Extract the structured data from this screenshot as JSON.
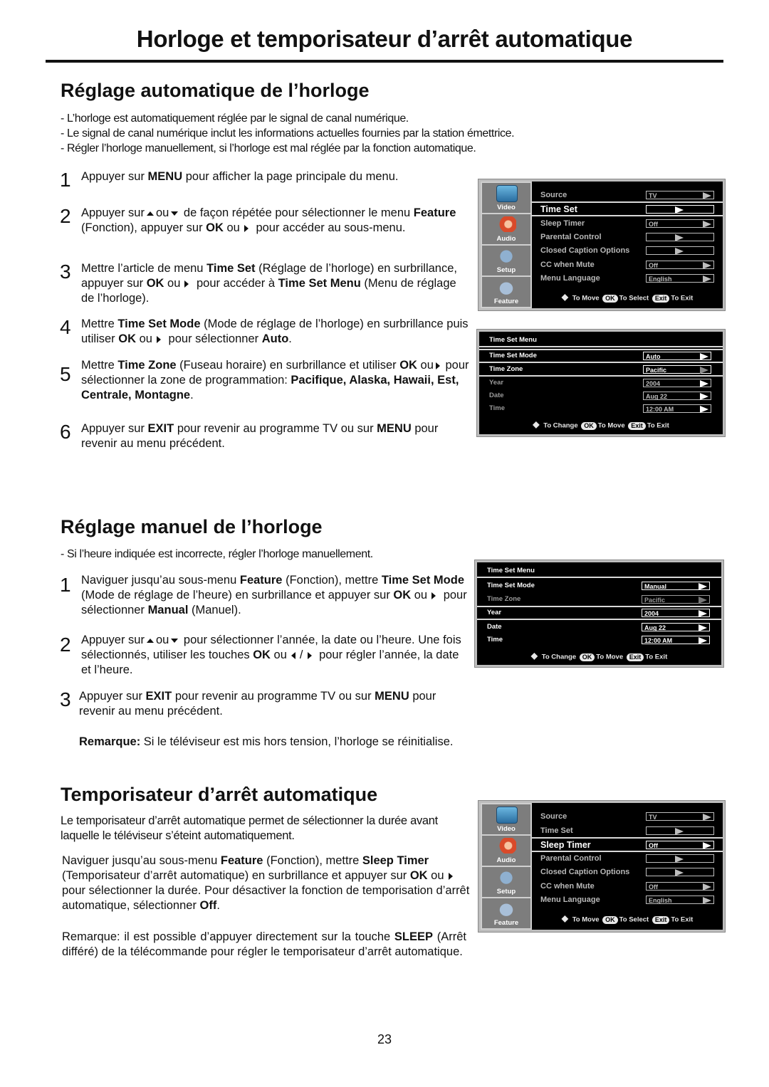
{
  "page": {
    "title": "Horloge et temporisateur d’arrêt automatique",
    "number": "23"
  },
  "auto": {
    "heading": "Réglage automatique de l’horloge",
    "bullets": [
      "- L’horloge est automatiquement réglée par le signal de canal numérique.",
      "- Le signal de canal numérique inclut les informations actuelles fournies par la station émettrice.",
      "- Régler l’horloge manuellement, si l’horloge est mal réglée par la fonction automatique."
    ],
    "steps": [
      {
        "num": "1",
        "parts": [
          "Appuyer sur ",
          "MENU",
          " pour afficher la page principale du menu."
        ]
      },
      {
        "num": "2",
        "parts": [
          "Appuyer sur",
          "ou",
          " de façon répétée pour sélectionner le menu ",
          "Feature",
          " (Fonction), appuyer sur ",
          "OK",
          " ou",
          " pour accéder au sous-menu."
        ]
      },
      {
        "num": "3",
        "parts": [
          "Mettre l’article de menu ",
          "Time Set",
          " (Réglage de l’horloge) en surbrillance, appuyer sur ",
          "OK",
          " ou",
          " pour accéder à ",
          "Time Set Menu",
          " (Menu de réglage de l’horloge)."
        ]
      },
      {
        "num": "4",
        "parts": [
          "Mettre ",
          "Time Set Mode",
          " (Mode de réglage de l’horloge) en surbrillance puis utiliser ",
          "OK",
          " ou",
          " pour sélectionner ",
          "Auto",
          "."
        ]
      },
      {
        "num": "5",
        "parts": [
          "Mettre ",
          "Time Zone",
          " (Fuseau horaire) en surbrillance et utiliser ",
          "OK",
          " ou",
          " pour sélectionner la zone de programmation: ",
          "Pacifique, Alaska, Hawaii, Est, Centrale, Montagne",
          "."
        ]
      },
      {
        "num": "6",
        "parts": [
          "Appuyer sur ",
          "EXIT",
          " pour revenir au programme TV ou sur ",
          "MENU",
          " pour revenir au menu précédent."
        ]
      }
    ]
  },
  "manual": {
    "heading": "Réglage manuel de l’horloge",
    "intro": "- Si l’heure indiquée est incorrecte, régler l’horloge manuellement.",
    "steps": [
      {
        "num": "1",
        "parts": [
          "Naviguer jusqu’au sous-menu ",
          "Feature",
          " (Fonction), mettre ",
          "Time Set Mode",
          " (Mode de réglage de l’heure) en surbrillance et appuyer sur ",
          "OK",
          " ou",
          " pour sélectionner ",
          "Manual",
          " (Manuel)."
        ]
      },
      {
        "num": "2",
        "parts": [
          "Appuyer sur",
          "ou",
          " pour sélectionner l’année, la date ou l’heure. Une fois sélectionnés, utiliser les touches ",
          "OK",
          " ou",
          "/",
          " pour régler l’année, la date et l’heure."
        ]
      },
      {
        "num": "3",
        "parts": [
          "Appuyer sur ",
          "EXIT",
          " pour revenir au programme TV ou sur ",
          "MENU",
          " pour revenir au menu précédent."
        ]
      }
    ],
    "note_label": "Remarque:",
    "note_text": " Si le téléviseur est mis hors tension, l’horloge se réinitialise."
  },
  "sleep": {
    "heading": "Temporisateur d’arrêt automatique",
    "intro": "Le temporisateur d’arrêt automatique permet de sélectionner la durée avant laquelle le téléviseur s’éteint automatiquement.",
    "body_parts": [
      "Naviguer jusqu’au sous-menu ",
      "Feature",
      " (Fonction), mettre ",
      "Sleep Timer",
      " (Temporisateur d’arrêt automatique) en surbrillance et appuyer sur ",
      "OK",
      " ou",
      " pour sélectionner la durée. Pour désactiver la fonction de temporisation d’arrêt automatique, sélectionner ",
      "Off",
      "."
    ],
    "note_parts": [
      "Remarque: il est possible d’appuyer directement sur la touche ",
      "SLEEP",
      " (Arrêt différé) de la télécommande pour régler le temporisateur d’arrêt automatique."
    ]
  },
  "feature_menu": {
    "side": [
      "Video",
      "Audio",
      "Setup",
      "Feature"
    ],
    "items": [
      {
        "label": "Source",
        "value": "TV"
      },
      {
        "label": "Time Set",
        "value": ""
      },
      {
        "label": "Sleep Timer",
        "value": "Off"
      },
      {
        "label": "Parental Control",
        "value": ""
      },
      {
        "label": "Closed Caption Options",
        "value": ""
      },
      {
        "label": "CC when Mute",
        "value": "Off"
      },
      {
        "label": "Menu Language",
        "value": "English"
      }
    ],
    "footer": {
      "move": "To Move",
      "ok": "OK",
      "select": "To Select",
      "exit_btn": "Exit",
      "exit": "To Exit"
    }
  },
  "time_set_menu_auto": {
    "title": "Time Set Menu",
    "items": [
      {
        "label": "Time Set Mode",
        "value": "Auto"
      },
      {
        "label": "Time Zone",
        "value": "Pacific"
      },
      {
        "label": "Year",
        "value": "2004"
      },
      {
        "label": "Date",
        "value": "Aug 22"
      },
      {
        "label": "Time",
        "value": "12:00  AM"
      }
    ],
    "footer": {
      "change": "To Change",
      "ok": "OK",
      "move": "To Move",
      "exit_btn": "Exit",
      "exit": "To Exit"
    }
  },
  "time_set_menu_manual": {
    "title": "Time Set Menu",
    "items": [
      {
        "label": "Time Set Mode",
        "value": "Manual"
      },
      {
        "label": "Time Zone",
        "value": "Pacific"
      },
      {
        "label": "Year",
        "value": "2004"
      },
      {
        "label": "Date",
        "value": "Aug 22"
      },
      {
        "label": "Time",
        "value": "12:00  AM"
      }
    ],
    "footer": {
      "change": "To Change",
      "ok": "OK",
      "move": "To Move",
      "exit_btn": "Exit",
      "exit": "To Exit"
    }
  }
}
